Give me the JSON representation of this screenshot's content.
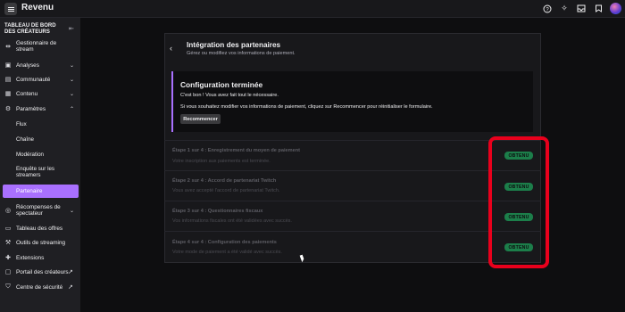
{
  "topbar": {
    "title": "Revenu",
    "icons": [
      "help-icon",
      "sparkle-icon",
      "inbox-icon",
      "bookmark-icon"
    ]
  },
  "sidebar": {
    "header": "TABLEAU DE BORD DES CRÉATEURS",
    "items": [
      {
        "label": "Gestionnaire de stream",
        "icon": "stream-manager-icon"
      },
      {
        "label": "Analyses",
        "icon": "analytics-icon"
      },
      {
        "label": "Communauté",
        "icon": "community-icon"
      },
      {
        "label": "Contenu",
        "icon": "content-icon"
      },
      {
        "label": "Paramètres",
        "icon": "settings-icon"
      },
      {
        "label": "Récompenses de spectateur",
        "icon": "rewards-icon"
      },
      {
        "label": "Tableau des offres",
        "icon": "offers-icon"
      },
      {
        "label": "Outils de streaming",
        "icon": "streaming-tools-icon"
      },
      {
        "label": "Extensions",
        "icon": "extensions-icon"
      },
      {
        "label": "Portail des créateurs",
        "icon": "creator-portal-icon"
      },
      {
        "label": "Centre de sécurité",
        "icon": "security-center-icon"
      }
    ],
    "sub_items": [
      "Flux",
      "Chaîne",
      "Modération",
      "Enquête sur les streamers",
      "Partenaire"
    ]
  },
  "main": {
    "title": "Intégration des partenaires",
    "subtitle": "Gérez ou modifiez vos informations de paiement.",
    "config": {
      "title": "Configuration terminée",
      "line1": "C'est bon ! Vous avez fait tout le nécessaire.",
      "line2": "Si vous souhaitez modifier vos informations de paiement, cliquez sur Recommencer pour réinitialiser le formulaire.",
      "button": "Recommencer"
    },
    "steps": [
      {
        "title": "Étape 1 sur 4 : Enregistrement du moyen de paiement",
        "desc": "Votre inscription aux paiements est terminée.",
        "status": "OBTENU"
      },
      {
        "title": "Étape 2 sur 4 : Accord de partenariat Twitch",
        "desc": "Vous avez accepté l'accord de partenariat Twitch.",
        "status": "OBTENU"
      },
      {
        "title": "Étape 3 sur 4 : Questionnaires fiscaux",
        "desc": "Vos informations fiscales ont été validées avec succès.",
        "status": "OBTENU"
      },
      {
        "title": "Étape 4 sur 4 : Configuration des paiements",
        "desc": "Votre mode de paiement a été validé avec succès.",
        "status": "OBTENU"
      }
    ]
  },
  "colors": {
    "accent": "#a970ff",
    "success": "#1c7e4a",
    "highlight": "#e8001c"
  }
}
